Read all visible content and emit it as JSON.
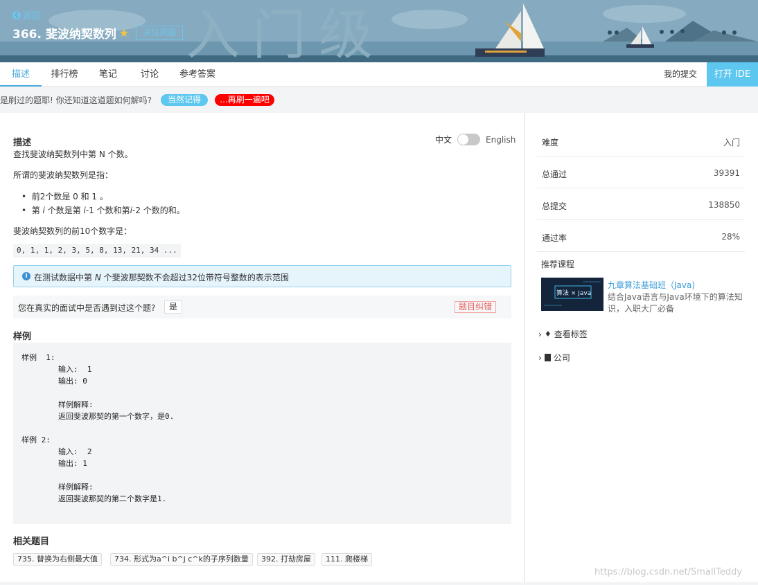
{
  "header": {
    "back_label": "返回",
    "title": "366. 斐波纳契数列",
    "follow_label": "关注问题",
    "banner_text": "入门级"
  },
  "tabs": [
    "描述",
    "排行榜",
    "笔记",
    "讨论",
    "参考答案"
  ],
  "my_submissions": "我的提交",
  "open_ide": "打开 IDE",
  "notice": {
    "text": "是刷过的题耶! 你还知道这道题如何解吗?",
    "remember_btn": "当然记得",
    "retry_btn": "...再刷一遍吧"
  },
  "description": {
    "heading": "描述",
    "lang_zh": "中文",
    "lang_en": "English",
    "intro": "查找斐波纳契数列中第 N 个数。",
    "def_line": "所谓的斐波纳契数列是指：",
    "bullet1": "前2个数是 0 和 1 。",
    "bullet2_a": "第 ",
    "bullet2_i1": "i",
    "bullet2_b": " 个数是第 ",
    "bullet2_i2": "i",
    "bullet2_c": "-1 个数和第",
    "bullet2_i3": "i",
    "bullet2_d": "-2 个数的和。",
    "first10_label": "斐波纳契数列的前10个数字是：",
    "sequence": "0, 1, 1, 2, 3, 5, 8, 13, 21, 34 ...",
    "info_a": "在测试数据中第 ",
    "info_n": "N",
    "info_b": " 个斐波那契数不会超过32位带符号整数的表示范围",
    "met_question": "您在真实的面试中是否遇到过这个题?",
    "met_yes": "是",
    "report": "题目纠错"
  },
  "examples": {
    "heading": "样例",
    "code": "样例  1:\n\t输入:  1\n\t输出: 0\n\t\n\t样例解释: \n\t返回斐波那契的第一个数字，是0.\n\n样例 2:\n\t输入:  2\n\t输出: 1\n\t\n\t样例解释: \n\t返回斐波那契的第二个数字是1."
  },
  "related": {
    "heading": "相关题目",
    "items": [
      "735. 替换为右侧最大值",
      "734. 形式为a^i b^j c^k的子序列数量",
      "392. 打劫房屋",
      "111. 爬楼梯"
    ]
  },
  "sidebar": {
    "stats": [
      {
        "label": "难度",
        "value": "入门"
      },
      {
        "label": "总通过",
        "value": "39391"
      },
      {
        "label": "总提交",
        "value": "138850"
      },
      {
        "label": "通过率",
        "value": "28%"
      }
    ],
    "course_heading": "推荐课程",
    "course_img_text": "算法 × Java",
    "course_title": "九章算法基础班（Java)",
    "course_desc": "结合Java语言与Java环境下的算法知识，入职大厂必备",
    "tags_label": "查看标签",
    "company_label": "公司"
  },
  "watermark": "https://blog.csdn.net/SmallTeddy",
  "colors": {
    "accent": "#4aa9da",
    "ide_button": "#5ec7ef",
    "retry": "#ff0000"
  }
}
